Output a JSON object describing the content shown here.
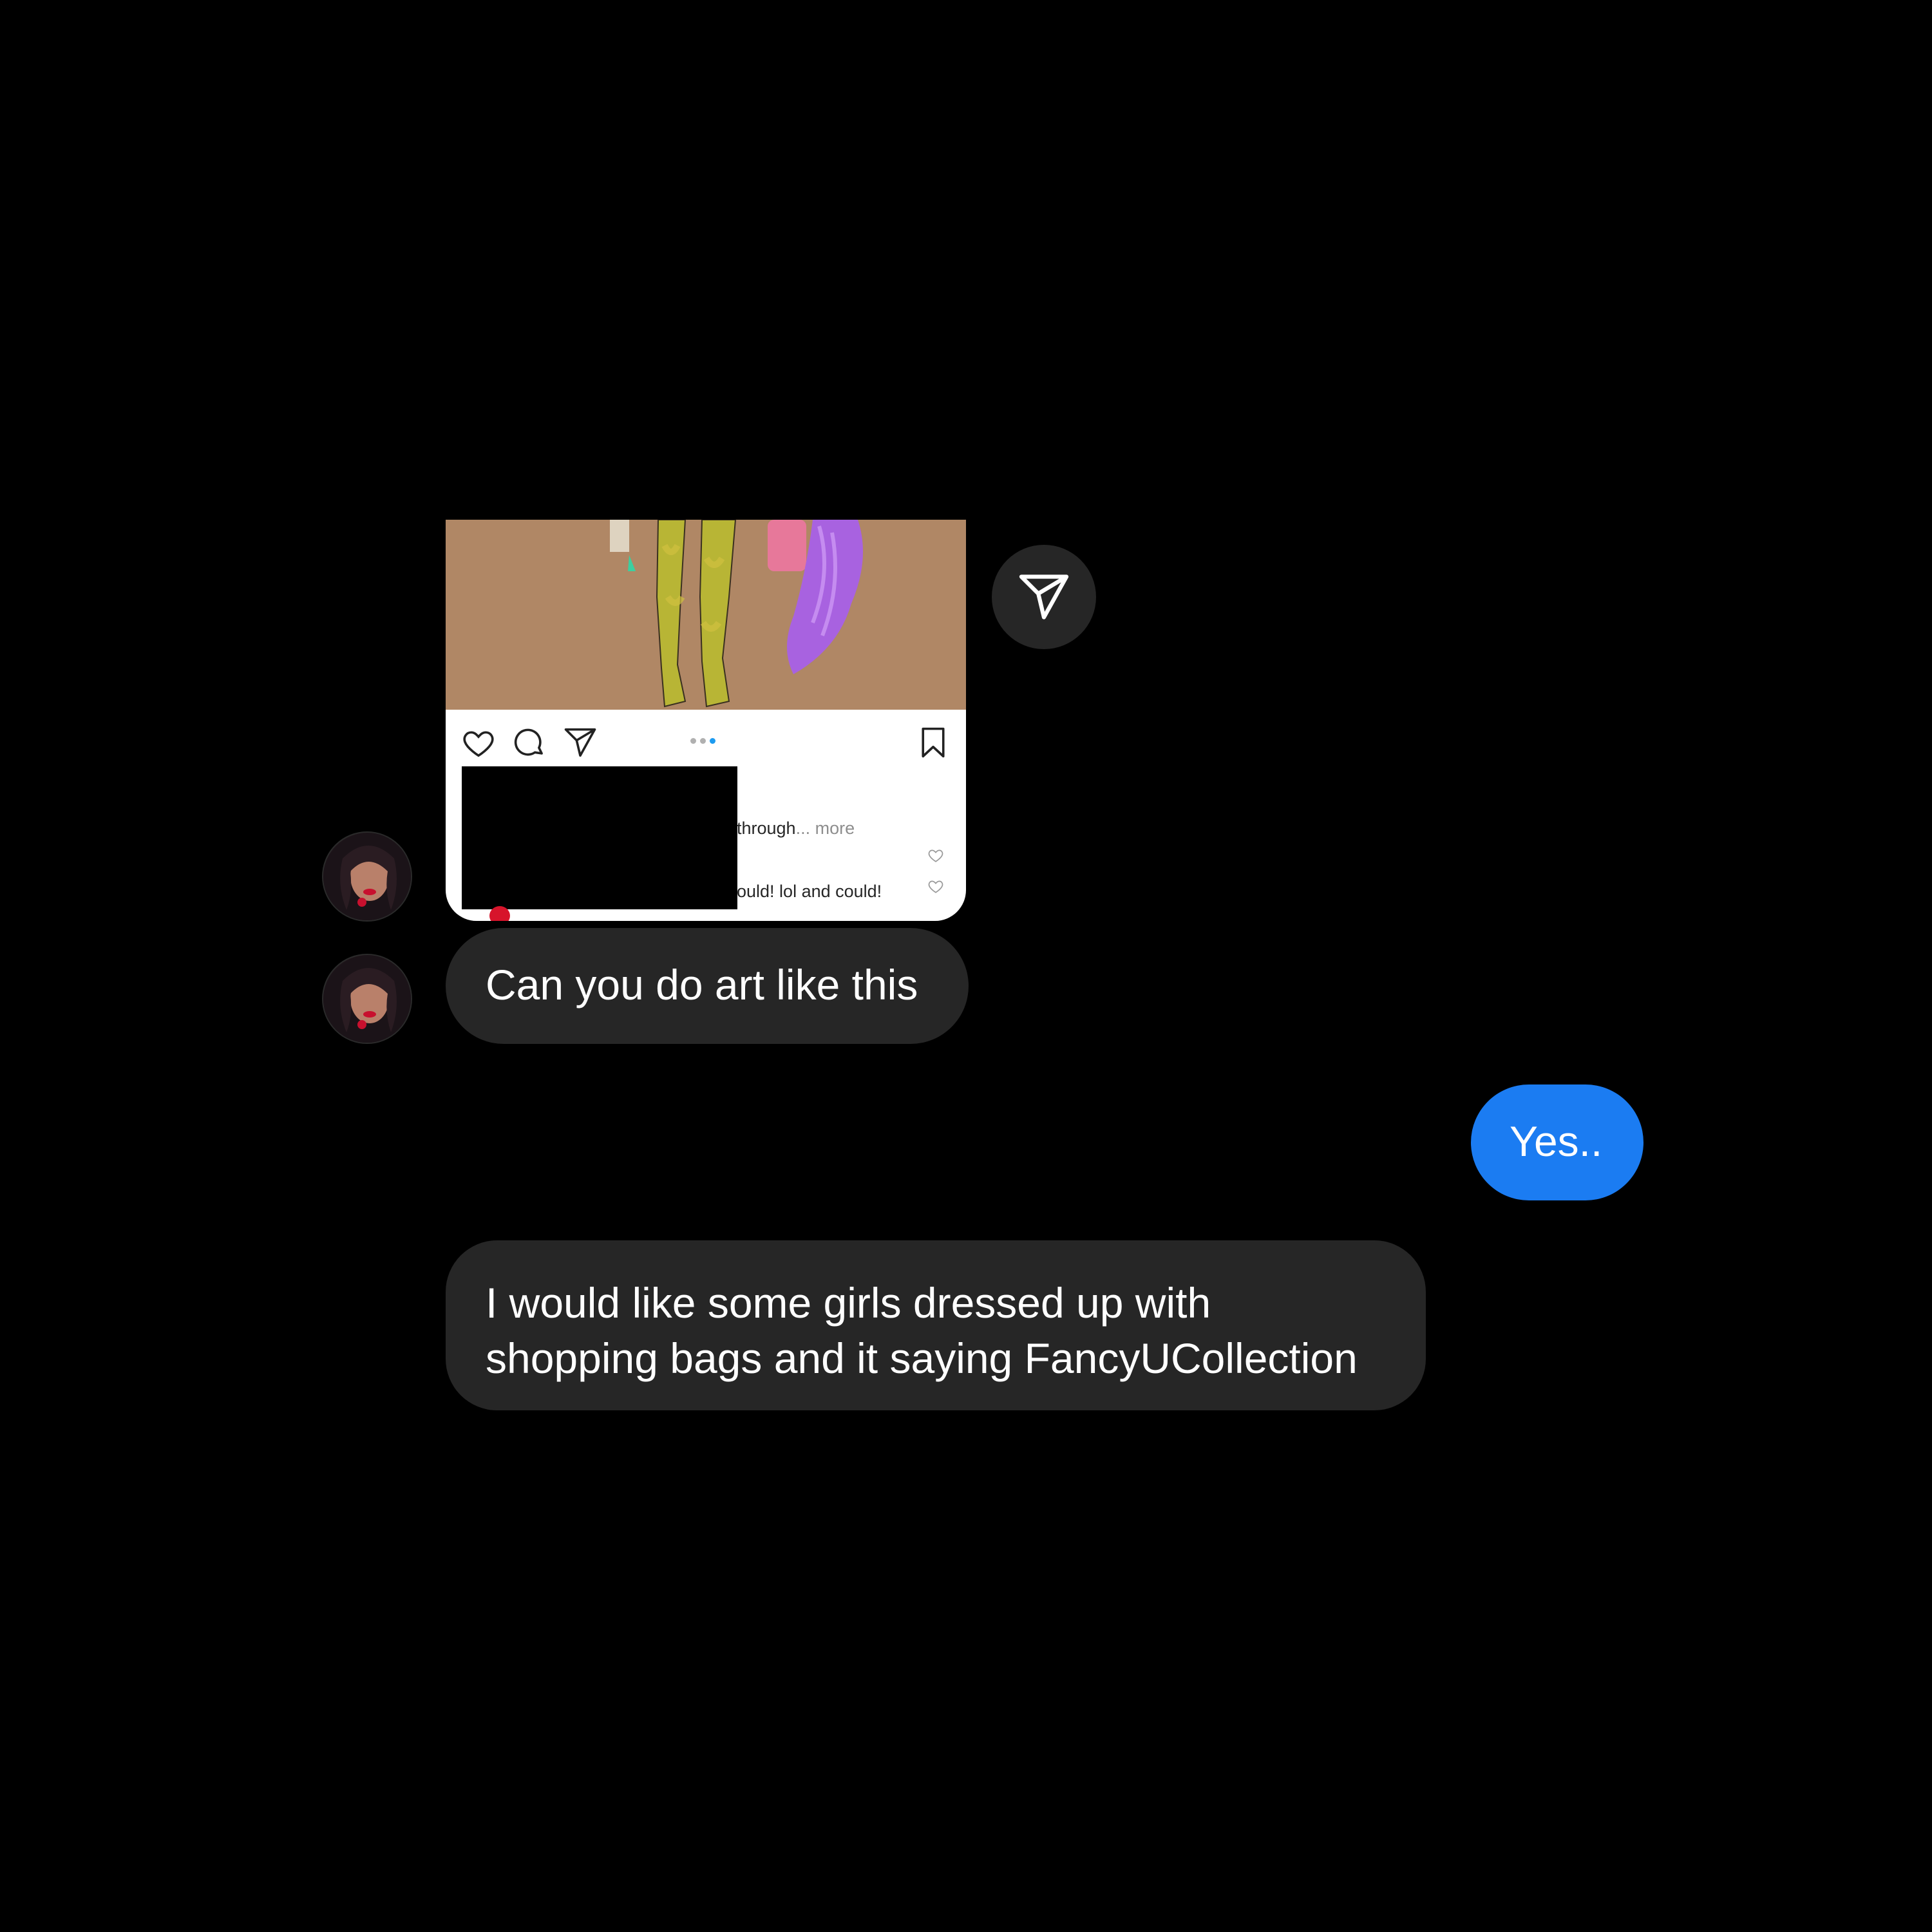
{
  "colors": {
    "background": "#000000",
    "incoming_bubble": "#262626",
    "outgoing_bubble": "#1b7cf2",
    "post_card": "#ffffff"
  },
  "shared_post": {
    "caption_line1": "through",
    "caption_more": "... more",
    "caption_line2": "ould! lol and could!",
    "carousel_pages": 3,
    "carousel_active": 3
  },
  "messages": [
    {
      "sender": "them",
      "text": "Can you do art like this"
    },
    {
      "sender": "me",
      "text": "Yes.."
    },
    {
      "sender": "them",
      "lines": [
        "I would like some girls dressed up with",
        "shopping bags and it saying FancyUCollection"
      ]
    }
  ]
}
